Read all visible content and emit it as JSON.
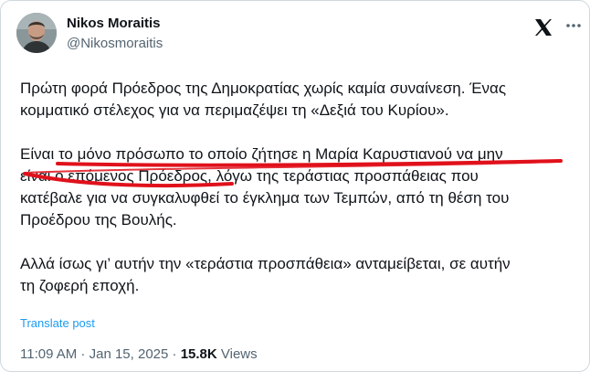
{
  "author": {
    "name": "Nikos Moraitis",
    "handle": "@Nikosmoraitis"
  },
  "icons": {
    "brand": "x-logo-icon",
    "more": "more-options-icon"
  },
  "post": {
    "p1": {
      "line1": "Πρώτη φορά Πρόεδρος της Δημοκρατίας χωρίς καμία συναίνεση. Ένας",
      "line2": "κομματικό στέλεχος για να περιμαζέψει τη «Δεξιά του Κυρίου»."
    },
    "p2": {
      "line1": "Είναι το μόνο πρόσωπο το οποίο ζήτησε η Μαρία Καρυστιανού να μην",
      "line2": "είναι ο επόμενος Πρόεδρος, λόγω της τεράστιας προσπάθειας που",
      "line3": "κατέβαλε για να συγκαλυφθεί το έγκλημα των Τεμπών, από τη θέση του",
      "line4": "Προέδρου της Βουλής."
    },
    "p3": {
      "line1": "Αλλά ίσως γι’ αυτήν την «τεράστια προσπάθεια» ανταμείβεται, σε αυτήν",
      "line2": "τη ζοφερή εποχή."
    }
  },
  "translate_label": "Translate post",
  "meta": {
    "time": "11:09 AM",
    "separator": " · ",
    "date": "Jan 15, 2025",
    "views_count": "15.8K",
    "views_label": " Views"
  },
  "colors": {
    "underline": "#e0111b",
    "link": "#1d9bf0",
    "secondary_text": "#536471"
  }
}
